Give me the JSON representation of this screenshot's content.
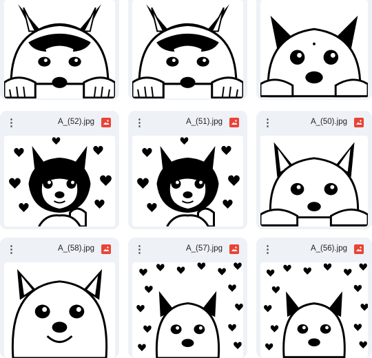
{
  "accent_color": "#ea4335",
  "card_color": "#eef1f6",
  "files": [
    {
      "name": "",
      "picture": "husky-dog-peeking"
    },
    {
      "name": "",
      "picture": "husky-dog-peeking"
    },
    {
      "name": "",
      "picture": "fluffy-puppy-peeking"
    },
    {
      "name": "A_(52).jpg",
      "picture": "shiba-puppy-with-hearts"
    },
    {
      "name": "A_(51).jpg",
      "picture": "shiba-puppy-with-hearts"
    },
    {
      "name": "A_(50).jpg",
      "picture": "fluffy-puppy-peeking"
    },
    {
      "name": "A_(58).jpg",
      "picture": "smiling-puppy"
    },
    {
      "name": "A_(57).jpg",
      "picture": "puppy-with-heart-pattern"
    },
    {
      "name": "A_(56).jpg",
      "picture": "puppy-with-heart-pattern"
    }
  ],
  "icons": {
    "menu": "more-vert-icon",
    "file_type": "image-file-icon"
  }
}
